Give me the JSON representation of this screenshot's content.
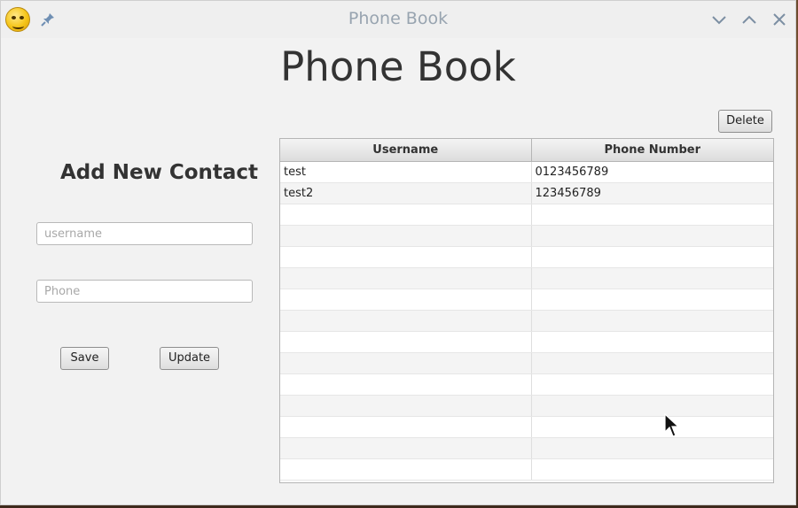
{
  "window": {
    "title": "Phone Book"
  },
  "icons": {
    "app": "grimace-emoji-icon",
    "pin": "pin-icon",
    "minimize": "chevron-down-icon",
    "maximize": "chevron-up-icon",
    "close": "close-icon",
    "cursor": "mouse-cursor-icon"
  },
  "header": {
    "title": "Phone Book"
  },
  "form": {
    "title": "Add New Contact",
    "username_placeholder": "username",
    "username_value": "",
    "phone_placeholder": "Phone",
    "phone_value": "",
    "save_label": "Save",
    "update_label": "Update"
  },
  "toolbar": {
    "delete_label": "Delete"
  },
  "table": {
    "columns": [
      "Username",
      "Phone Number"
    ],
    "rows": [
      [
        "test",
        "0123456789"
      ],
      [
        "test2",
        "123456789"
      ],
      [
        "",
        ""
      ],
      [
        "",
        ""
      ],
      [
        "",
        ""
      ],
      [
        "",
        ""
      ],
      [
        "",
        ""
      ],
      [
        "",
        ""
      ],
      [
        "",
        ""
      ],
      [
        "",
        ""
      ],
      [
        "",
        ""
      ],
      [
        "",
        ""
      ],
      [
        "",
        ""
      ],
      [
        "",
        ""
      ],
      [
        "",
        ""
      ]
    ]
  },
  "colors": {
    "title_text": "#98a4b0",
    "window_bg": "#f2f2f2",
    "text": "#333333"
  }
}
